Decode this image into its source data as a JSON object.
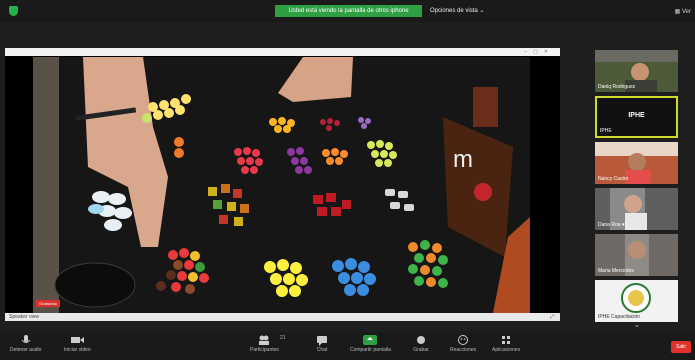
{
  "topbar": {
    "share_banner": "Usted está viendo la pantalla de otros iphone",
    "share_options": "Opciones de vista",
    "view": "Ver"
  },
  "shared_window": {
    "status": "Speaker view",
    "recording": "Grabando"
  },
  "participants": [
    {
      "name": "Daniq Rodriguez"
    },
    {
      "name": "IPHE",
      "active": true
    },
    {
      "name": "Nancy Castro"
    },
    {
      "name": "Dana Roa ♥"
    },
    {
      "name": "Maria Mercedes"
    },
    {
      "name": "IPHE Capacitación"
    }
  ],
  "toolbar": [
    {
      "label": "Detener audio",
      "icon": "microphone-icon"
    },
    {
      "label": "Iniciar video",
      "icon": "video-camera-icon"
    },
    {
      "label": "Participantes",
      "icon": "participants-icon",
      "count": "21"
    },
    {
      "label": "Chat",
      "icon": "chat-icon"
    },
    {
      "label": "Compartir pantalla",
      "icon": "share-screen-icon"
    },
    {
      "label": "Grabar",
      "icon": "record-icon"
    },
    {
      "label": "Reacciones",
      "icon": "reactions-icon"
    },
    {
      "label": "Aplicaciones",
      "icon": "apps-icon"
    }
  ],
  "end_button": "Salir",
  "colors": {
    "banner_green": "#2ea043",
    "active_speaker": "#cddb2a",
    "end_red": "#e0312c"
  }
}
